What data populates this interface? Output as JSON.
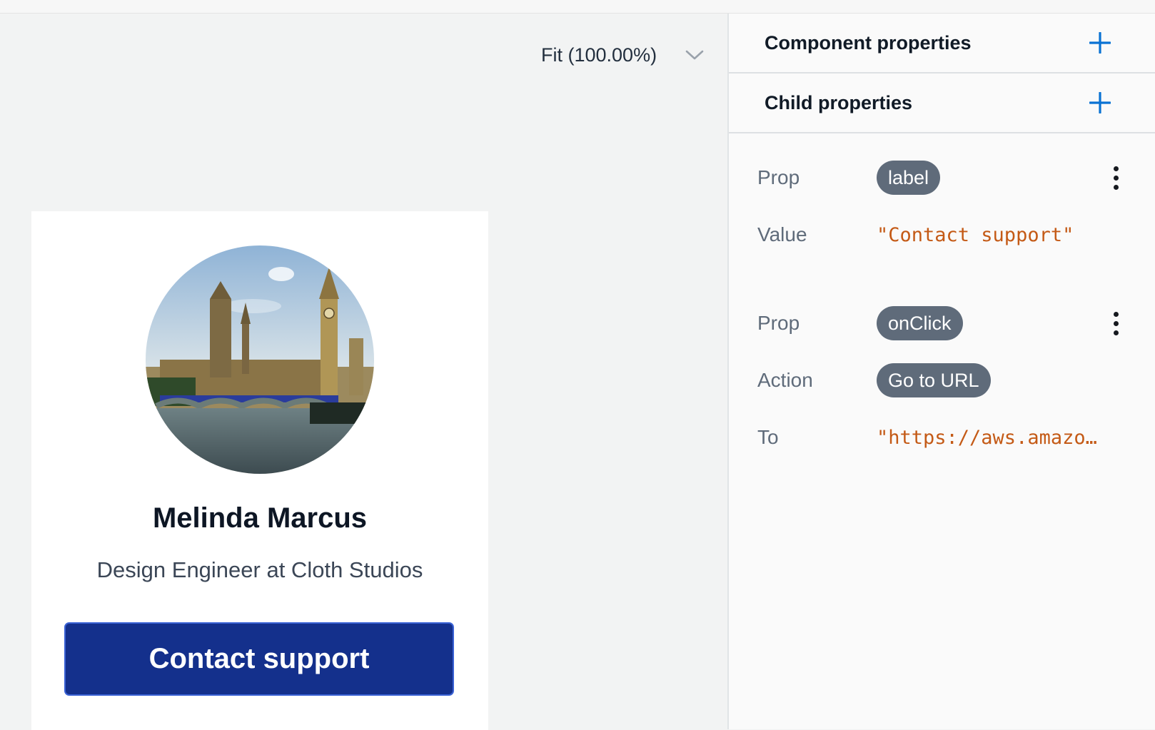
{
  "canvas": {
    "zoom_label": "Fit (100.00%)"
  },
  "card": {
    "name": "Melinda Marcus",
    "subtitle": "Design Engineer at Cloth Studios",
    "button_label": "Contact support"
  },
  "panel": {
    "component_properties": "Component properties",
    "child_properties": "Child properties",
    "rows": [
      {
        "key": "Prop",
        "value": "label"
      },
      {
        "key": "Value",
        "value": "\"Contact support\""
      },
      {
        "key": "Prop",
        "value": "onClick"
      },
      {
        "key": "Action",
        "value": "Go to URL"
      },
      {
        "key": "To",
        "value": "\"https://aws.amazo…"
      }
    ]
  },
  "colors": {
    "accent_blue": "#0972d3",
    "button_blue": "#14308c",
    "pill_gray": "#5f6b7a",
    "code_orange": "#c45a16"
  },
  "icons": {
    "zoom_dropdown": "chevron-down-icon",
    "add": "plus-icon",
    "more": "kebab-menu-icon"
  }
}
